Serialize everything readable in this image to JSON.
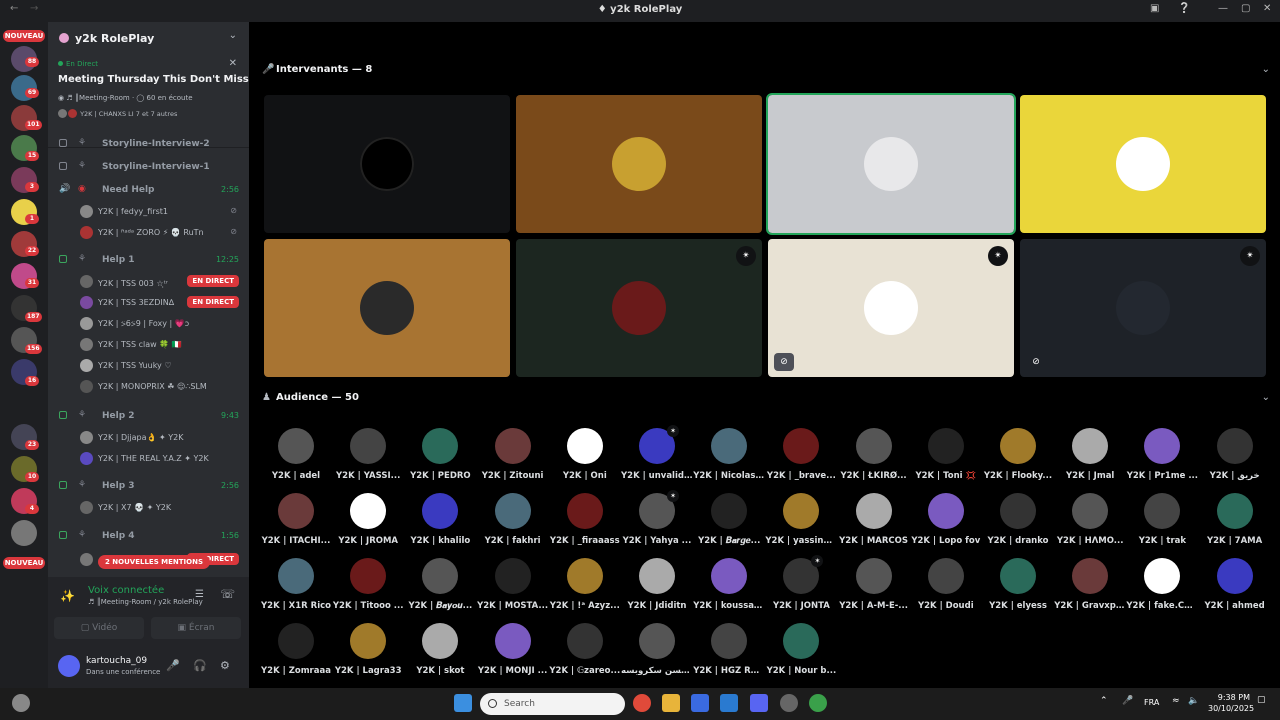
{
  "window": {
    "title": "y2k RolePlay"
  },
  "rail": {
    "nouveau_label": "NOUVEAU",
    "badges": [
      "88",
      "69",
      "101",
      "15",
      "3",
      "1",
      "22",
      "31",
      "187",
      "156",
      "16",
      "23",
      "10",
      "4"
    ]
  },
  "server": {
    "name": "y2k RolePlay"
  },
  "event": {
    "live_label": "En Direct",
    "title": "Meeting Thursday This Don't Miss Out",
    "location": "║Meeting-Room",
    "listeners": "60 en écoute",
    "speakers_line": "Y2K | CHANXS LI 7 et 7 autres"
  },
  "channels": [
    {
      "name": "Storyline-Interview-2",
      "time": ""
    },
    {
      "name": "Storyline-Interview-1",
      "time": ""
    },
    {
      "name": "Need Help",
      "time": "2:56"
    },
    {
      "name": "Help 1",
      "time": "12:25"
    },
    {
      "name": "Help 2",
      "time": "9:43"
    },
    {
      "name": "Help 3",
      "time": "2:56"
    },
    {
      "name": "Help 4",
      "time": "1:56"
    }
  ],
  "voice_users": {
    "need_help": [
      "Y2K | fedyy_first1",
      "Y2K | ᴿᵃᵈᵃ ZORO ⚡ 💀 RuTn"
    ],
    "help1": [
      "Y2K | TSS 003 ☆ฺᵗʳ",
      "Y2K | TSS 3EZDIN∆",
      "Y2K | ⍩6⍩9 | Foxy | 💗ↄ",
      "Y2K | TSS claw 🍀 🇮🇹",
      "Y2K | TSS Yuuky ♡",
      "Y2K | MONOPRIX ☘ 😌∴SLM"
    ],
    "help2": [
      "Y2K | Djjapa👌 ✦ Y2K",
      "Y2K | THE REAL Y.A.Z ✦ Y2K"
    ],
    "help3": [
      "Y2K | X7 💀 ✦ Y2K"
    ]
  },
  "live_badge": "EN DIRECT",
  "mentions_label": "2 NOUVELLES MENTIONS",
  "voice_panel": {
    "status": "Voix connectée",
    "location": "║Meeting-Room / y2k RolePlay",
    "video_label": "Vidéo",
    "screen_label": "Écran"
  },
  "account": {
    "username": "kartoucha_09",
    "status": "Dans une conférence"
  },
  "stage": {
    "speakers_header": "Intervenants — 8",
    "audience_header": "Audience — 50"
  },
  "audience": [
    "Y2K | adel",
    "Y2K | YASSI...",
    "Y2K | PEDRO",
    "Y2K | Zitouni",
    "Y2K | Oni",
    "Y2K | unvalid ...",
    "Y2K | Nicolas ...",
    "Y2K | _brave...",
    "Y2K | ŁKIRØ...",
    "Y2K | Toni 💢",
    "Y2K | Flooky...",
    "Y2K | Jmal",
    "Y2K | Pr1me ...",
    "Y2K | خريق",
    "Y2K | ITACHI...",
    "Y2K | JROMA",
    "Y2K | khalilo",
    "Y2K | fakhri",
    "Y2K | _firaaass",
    "Y2K | Yahya ...",
    "Y2K | 𝑩𝒂𝒓𝒈𝒆...",
    "Y2K | yassine ...",
    "Y2K | MARCOS",
    "Y2K | Lopo fov",
    "Y2K | dranko",
    "Y2K | HΛMO...",
    "Y2K | trak",
    "Y2K | 7AMA",
    "Y2K | X1R Rico",
    "Y2K | Titooo ...",
    "Y2K | 𝑩𝒂𝒚𝒐𝒖...",
    "Y2K | MOSTA...",
    "Y2K | !ᵃ Azyz...",
    "Y2K | Jdiditn",
    "Y2K | koussay...",
    "Y2K | JONTA",
    "Y2K | A-M-E-...",
    "Y2K | Doudi",
    "Y2K | elyess",
    "Y2K | Gravxpi...",
    "Y2K | fake.Ca...",
    "Y2K | ahmed",
    "Y2K | Zomraaa",
    "Y2K | Lagra33",
    "Y2K | skot",
    "Y2K | MONJI ...",
    "Y2K | 𝔾zareo...",
    "هسن سكروبسه hsn...",
    "Y2K | HGZ RA...",
    "Y2K | Nour b..."
  ],
  "taskbar": {
    "search_placeholder": "Search",
    "lang": "FRA",
    "time": "9:38 PM",
    "date": "30/10/2025"
  },
  "colors": {
    "live_green": "#23a55a",
    "alert_red": "#da373c",
    "panel": "#2b2d31",
    "rail": "#1e1f22"
  }
}
